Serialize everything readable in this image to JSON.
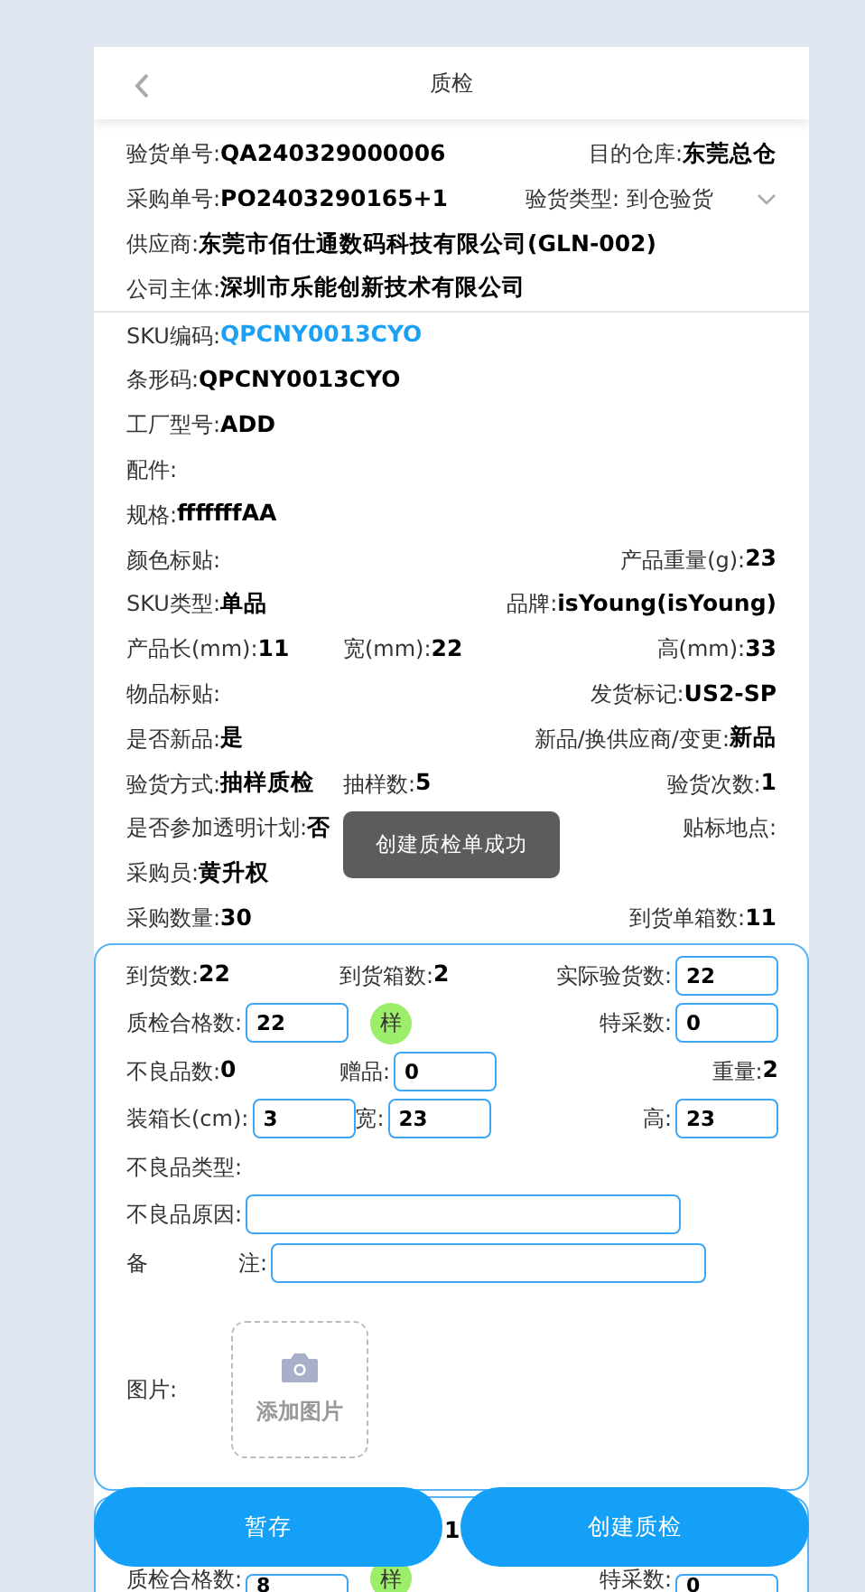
{
  "header": {
    "title": "质检"
  },
  "order_info": [
    [
      {
        "label": "验货单号:",
        "value": "QA240329000006",
        "kind": "text"
      },
      {
        "label": "目的仓库:",
        "value": "东莞总仓",
        "kind": "text"
      }
    ],
    [
      {
        "label": "采购单号:",
        "value": "PO2403290165+1",
        "kind": "text"
      },
      {
        "label": "验货类型:",
        "value": "到仓验货",
        "kind": "select"
      }
    ],
    [
      {
        "label": "供应商:",
        "value": "东莞市佰仕通数码科技有限公司(GLN-002)",
        "kind": "text"
      }
    ],
    [
      {
        "label": "公司主体:",
        "value": "深圳市乐能创新技术有限公司",
        "kind": "text"
      }
    ]
  ],
  "sku_info": [
    [
      {
        "label": "SKU编码:",
        "value": "QPCNY0013CYO",
        "kind": "link"
      }
    ],
    [
      {
        "label": "条形码:",
        "value": "QPCNY0013CYO",
        "kind": "text"
      }
    ],
    [
      {
        "label": "工厂型号:",
        "value": "ADD",
        "kind": "text"
      }
    ],
    [
      {
        "label": "配件:"
      }
    ],
    [
      {
        "label": "规格:",
        "value": "fffffffAA",
        "kind": "text"
      }
    ],
    [
      {
        "label": "颜色标贴:"
      },
      {
        "label": "产品重量(g):",
        "value": "23",
        "kind": "text"
      }
    ],
    [
      {
        "label": "SKU类型:",
        "value": "单品",
        "kind": "text"
      },
      {
        "label": "品牌:",
        "value": "isYoung(isYoung)",
        "kind": "text"
      }
    ],
    [
      {
        "label": "产品长(mm):",
        "value": "11",
        "kind": "text"
      },
      {
        "label": "宽(mm):",
        "value": "22",
        "kind": "text"
      },
      {
        "label": "高(mm):",
        "value": "33",
        "kind": "text"
      }
    ],
    [
      {
        "label": "物品标贴:"
      },
      {
        "label": "发货标记:",
        "value": "US2-SP",
        "kind": "text"
      }
    ],
    [
      {
        "label": "是否新品:",
        "value": "是",
        "kind": "text"
      },
      {
        "label": "新品/换供应商/变更:",
        "value": "新品",
        "kind": "text"
      }
    ],
    [
      {
        "label": "验货方式:",
        "value": "抽样质检",
        "kind": "text"
      },
      {
        "label": "抽样数:",
        "value": "5",
        "kind": "text"
      },
      {
        "label": "验货次数:",
        "value": "1",
        "kind": "text"
      }
    ],
    [
      {
        "label": "是否参加透明计划:",
        "value": "否",
        "kind": "text"
      },
      {
        "label": "贴标地点:"
      }
    ],
    [
      {
        "label": "采购员:",
        "value": "黄升权",
        "kind": "text"
      }
    ],
    [
      {
        "label": "采购数量:",
        "value": "30",
        "kind": "text"
      },
      {
        "label": "到货单箱数:",
        "value": "11",
        "kind": "text"
      }
    ]
  ],
  "inspection_cards": [
    {
      "rows": [
        [
          {
            "kind": "stat",
            "label": "到货数:",
            "value": "22"
          },
          {
            "kind": "stat",
            "label": "到货箱数:",
            "value": "2"
          },
          {
            "kind": "input",
            "label": "实际验货数:",
            "value": "22"
          }
        ],
        [
          {
            "kind": "input",
            "label": "质检合格数:",
            "value": "22"
          },
          {
            "kind": "badge",
            "value": "样"
          },
          {
            "kind": "input",
            "label": "特采数:",
            "value": "0"
          }
        ],
        [
          {
            "kind": "stat",
            "label": "不良品数:",
            "value": "0"
          },
          {
            "kind": "input",
            "label": "赠品:",
            "value": "0"
          },
          {
            "kind": "stat",
            "label": "重量:",
            "value": "2"
          }
        ],
        [
          {
            "kind": "input",
            "label": "装箱长(cm):",
            "value": "3"
          },
          {
            "kind": "input",
            "label": "宽:",
            "value": "23"
          },
          {
            "kind": "input",
            "label": "高:",
            "value": "23"
          }
        ],
        [
          {
            "kind": "stat",
            "label": "不良品类型:"
          }
        ],
        [
          {
            "kind": "wide_input",
            "label": "不良品原因:"
          }
        ],
        [
          {
            "kind": "wide_input",
            "label_parts": [
              "备",
              "注:"
            ]
          }
        ],
        [
          {
            "kind": "upload",
            "label": "图片:",
            "value": "添加图片"
          }
        ]
      ]
    },
    {
      "rows": [
        [
          {
            "kind": "stat",
            "value": "1"
          }
        ],
        [
          {
            "kind": "input",
            "label": "质检合格数:",
            "value": "8"
          },
          {
            "kind": "badge",
            "value": "样"
          },
          {
            "kind": "input",
            "label": "特采数:",
            "value": "0"
          }
        ]
      ]
    }
  ],
  "buttons": [
    {
      "label": "暂存"
    },
    {
      "label": "创建质检"
    }
  ],
  "toast": "创建质检单成功"
}
